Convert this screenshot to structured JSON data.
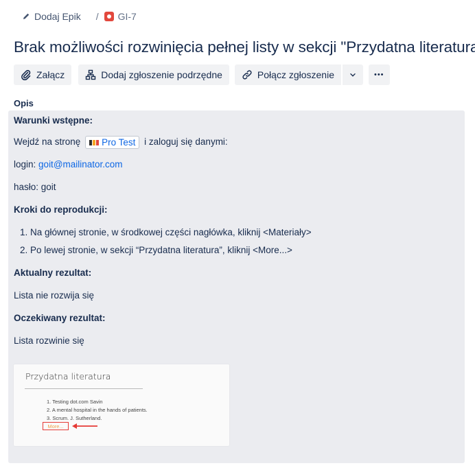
{
  "breadcrumb": {
    "epic_label": "Dodaj Epik",
    "separator": "/",
    "issue_key": "GI-7"
  },
  "issue": {
    "title": "Brak możliwości rozwinięcia pełnej listy w sekcji \"Przydatna literatura\""
  },
  "toolbar": {
    "attach": "Załącz",
    "add_child": "Dodaj zgłoszenie podrzędne",
    "link_issue": "Połącz zgłoszenie",
    "more": "•••"
  },
  "description": {
    "label": "Opis",
    "preconditions_heading": "Warunki wstępne:",
    "visit_prefix": "Wejdź na stronę",
    "site_chip": "Pro Test",
    "visit_suffix": "i zaloguj się danymi:",
    "login_prefix": "login:",
    "login_value": "goit@mailinator.com",
    "password_line": "hasło: goit",
    "steps_heading": "Kroki do reprodukcji:",
    "steps": [
      "1. Na głównej stronie, w środkowej części nagłówka, kliknij <Materiały>",
      "2. Po lewej stronie, w sekcji “Przydatna literatura”, kliknij <More...>"
    ],
    "actual_heading": "Aktualny rezultat:",
    "actual_text": "Lista nie rozwija się",
    "expected_heading": "Oczekiwany rezultat:",
    "expected_text": "Lista rozwinie się"
  },
  "attachment": {
    "title": "Przydatna literatura",
    "items": [
      "1. Testing dot.com Savin",
      "2. A mental hospital in the hands of patients.",
      "3. Scrum. J. Sutherland."
    ],
    "more_link": "More..."
  },
  "colors": {
    "link": "#0c66e4",
    "bug_icon": "#e2483d",
    "description_bg": "#ebecf0",
    "highlight_red": "#e53935"
  }
}
